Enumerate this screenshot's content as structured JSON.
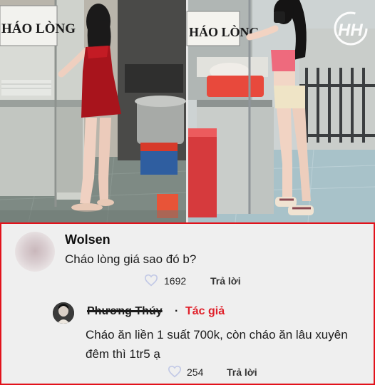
{
  "photo": {
    "left_sign": "HÁO LÒNG",
    "right_sign": "HÁO LÒNG",
    "logo_icon": "hh-watermark-icon"
  },
  "comment": {
    "author": "Wolsen",
    "text": "Cháo lòng giá sao đó b?",
    "likes": "1692",
    "reply_label": "Trả lời",
    "like_icon": "heart-outline-icon"
  },
  "reply": {
    "author": "Phương Thúy",
    "separator": "·",
    "badge": "Tác giả",
    "text": "Cháo ăn liền 1 suất 700k, còn cháo ăn lâu xuyên đêm thì 1tr5 ạ",
    "likes": "254",
    "reply_label": "Trả lời",
    "like_icon": "heart-outline-icon"
  },
  "colors": {
    "panel_border": "#e2121b",
    "author_badge": "#e0202a",
    "panel_bg": "#efefef"
  }
}
